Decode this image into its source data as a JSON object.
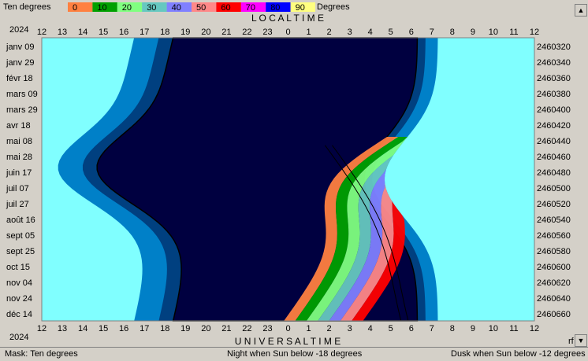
{
  "window": {
    "legend_label": "Ten degrees",
    "legend_unit": "Degrees",
    "legend_values": [
      "0",
      "10",
      "20",
      "30",
      "40",
      "50",
      "60",
      "70",
      "80",
      "90"
    ],
    "legend_colors": [
      "#ff8040",
      "#00a000",
      "#80ff80",
      "#66c8c0",
      "#8080ff",
      "#ff8888",
      "#ff0000",
      "#ff00ff",
      "#0000ff",
      "#ffff80"
    ],
    "status_mask": "Mask:  Ten degrees",
    "status_night": "Night when Sun below -18 degrees",
    "status_dusk": "Dusk when Sun below -12 degrees",
    "corner_label": "rf"
  },
  "chart_data": {
    "type": "area",
    "title_top": "L O C A L     T I M E",
    "title_bottom": "U N I V E R S A L     T I M E",
    "year_label": "2024",
    "x_ticks": [
      "12",
      "13",
      "14",
      "15",
      "16",
      "17",
      "18",
      "19",
      "20",
      "21",
      "22",
      "23",
      "0",
      "1",
      "2",
      "3",
      "4",
      "5",
      "6",
      "7",
      "8",
      "9",
      "10",
      "11",
      "12"
    ],
    "y_left_labels": [
      "janv 09",
      "janv 29",
      "févr 18",
      "mars 09",
      "mars 29",
      "avr 18",
      "mai 08",
      "mai 28",
      "juin 17",
      "juil 07",
      "juil 27",
      "août 16",
      "sept 05",
      "sept 25",
      "oct 15",
      "nov 04",
      "nov 24",
      "déc 14"
    ],
    "y_right_labels": [
      "2460320",
      "2460340",
      "2460360",
      "2460380",
      "2460400",
      "2460420",
      "2460440",
      "2460460",
      "2460480",
      "2460500",
      "2460520",
      "2460540",
      "2460560",
      "2460580",
      "2460600",
      "2460620",
      "2460640",
      "2460660"
    ],
    "colors": {
      "day": "#80ffff",
      "twilight_outer": "#0080c8",
      "twilight_inner": "#004080",
      "night": "#000040"
    }
  }
}
